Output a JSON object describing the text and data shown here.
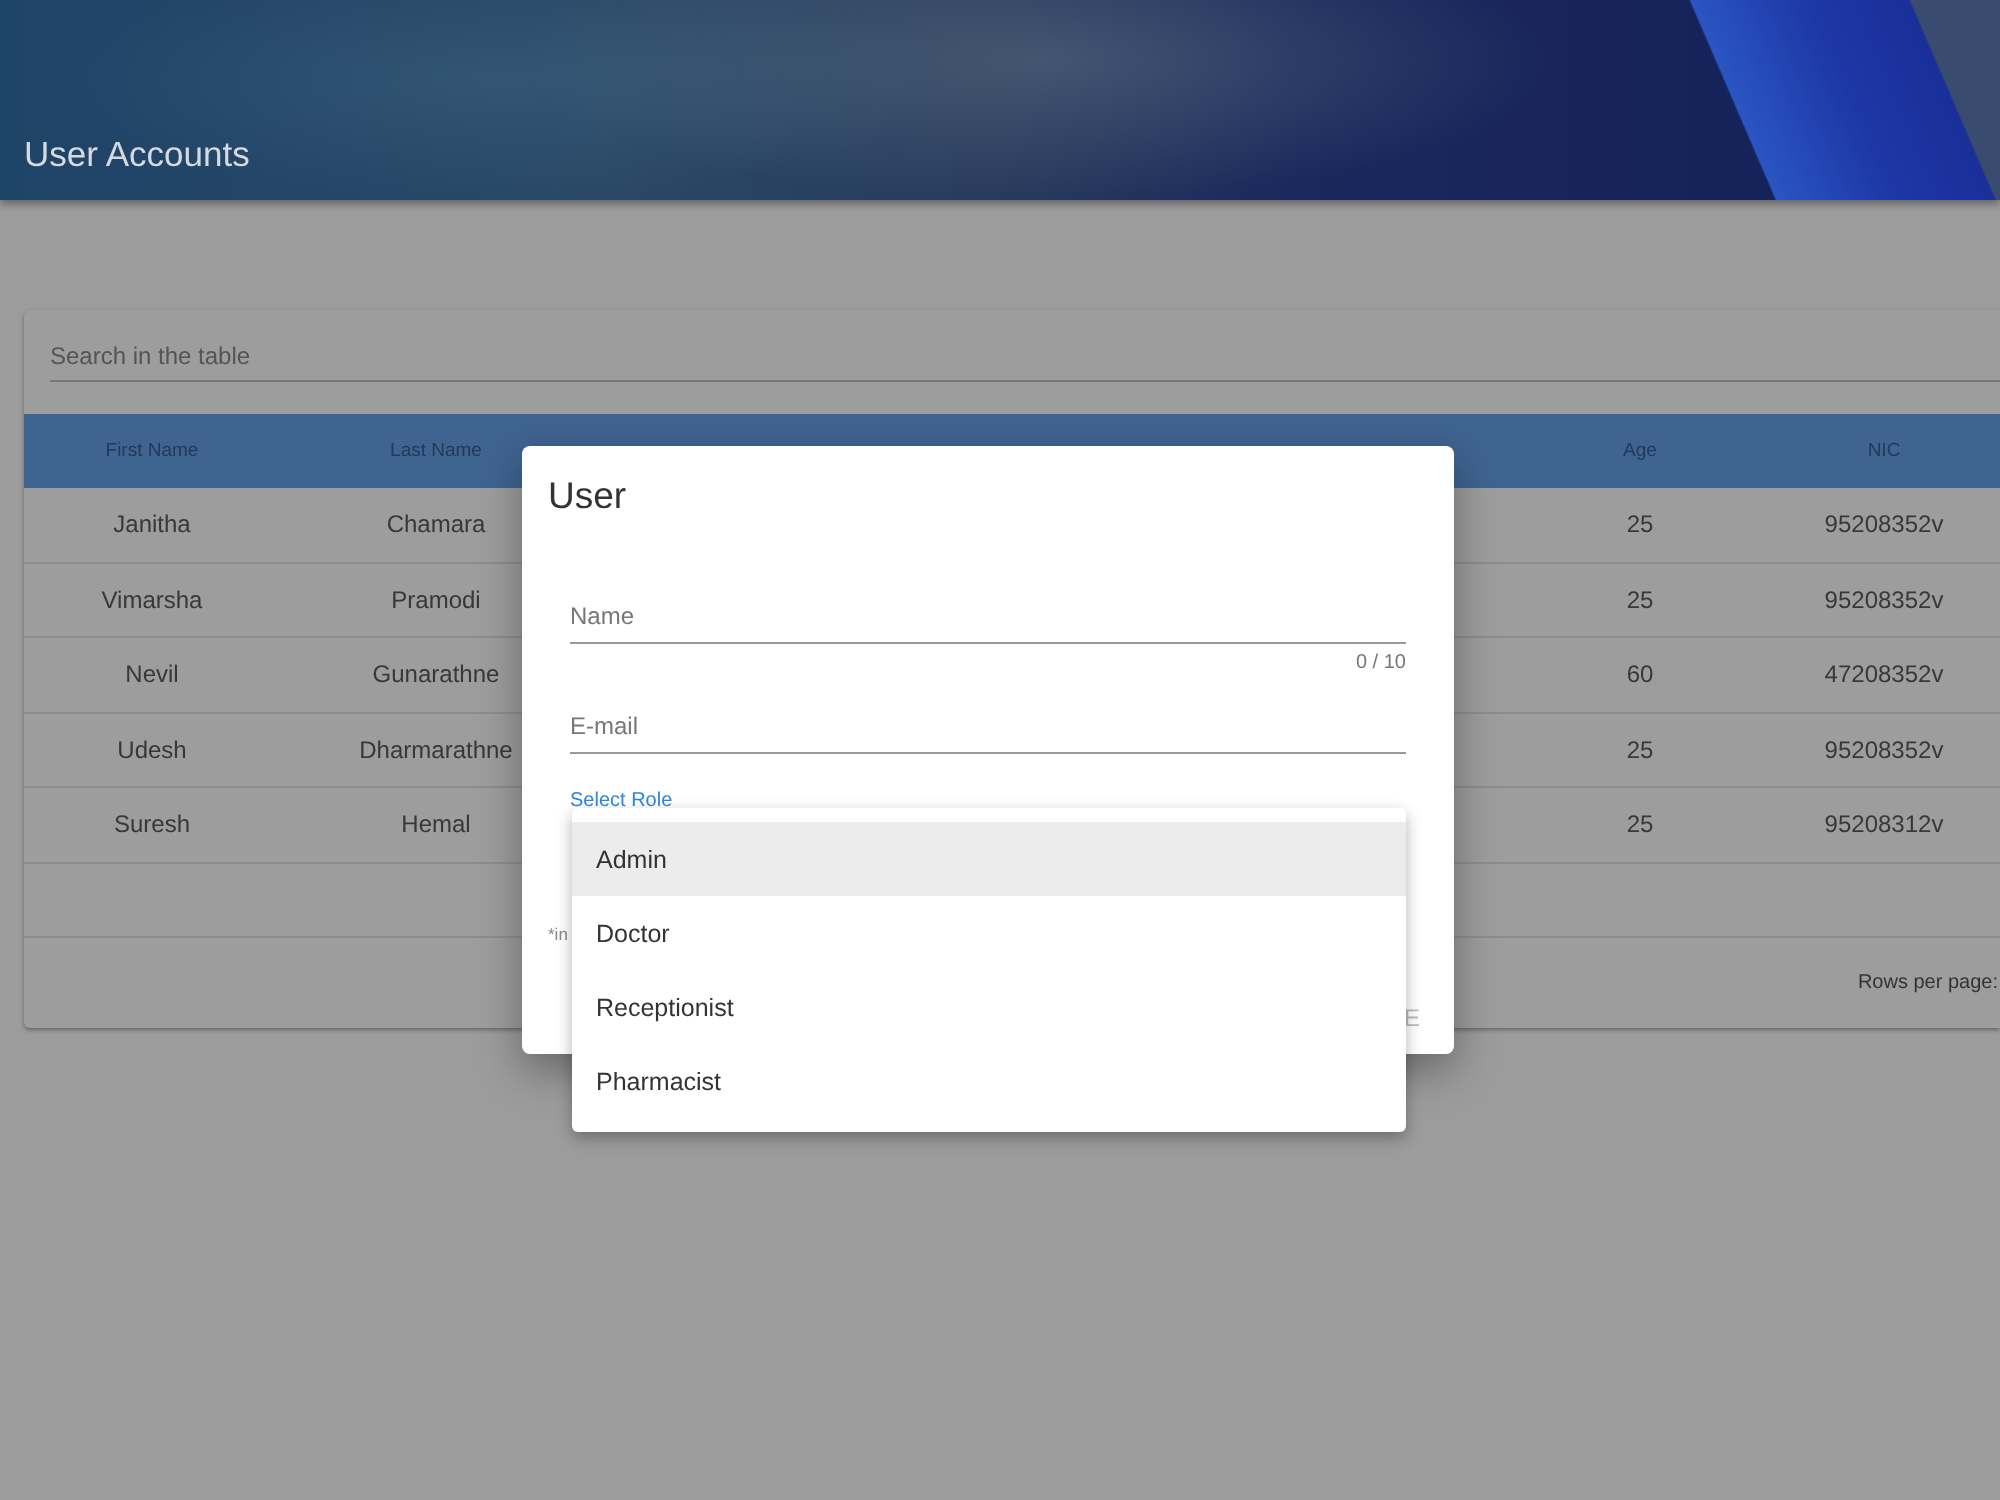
{
  "header": {
    "title": "User Accounts"
  },
  "table": {
    "search": {
      "placeholder": "Search in the table"
    },
    "columns": [
      {
        "label": "First Name"
      },
      {
        "label": "Last Name"
      },
      {
        "label": "Age"
      },
      {
        "label": "NIC"
      }
    ],
    "rows": [
      {
        "cells": [
          "Janitha",
          "Chamara",
          "25",
          "95208352v"
        ]
      },
      {
        "cells": [
          "Vimarsha",
          "Pramodi",
          "25",
          "95208352v"
        ]
      },
      {
        "cells": [
          "Nevil",
          "Gunarathne",
          "60",
          "47208352v"
        ]
      },
      {
        "cells": [
          "Udesh",
          "Dharmarathne",
          "25",
          "95208352v"
        ]
      },
      {
        "cells": [
          "Suresh",
          "Hemal",
          "25",
          "95208312v"
        ]
      }
    ],
    "footer": {
      "rows_per_page_label": "Rows per page:"
    }
  },
  "dialog": {
    "title": "User",
    "fields": [
      {
        "placeholder": "Name",
        "counter": "0 / 10"
      },
      {
        "placeholder": "E-mail"
      }
    ],
    "role_select": {
      "label": "Select Role",
      "options": [
        {
          "label": "Admin",
          "selected": true
        },
        {
          "label": "Doctor",
          "selected": false
        },
        {
          "label": "Receptionist",
          "selected": false
        },
        {
          "label": "Pharmacist",
          "selected": false
        }
      ]
    },
    "note": "*in",
    "action": "E"
  }
}
